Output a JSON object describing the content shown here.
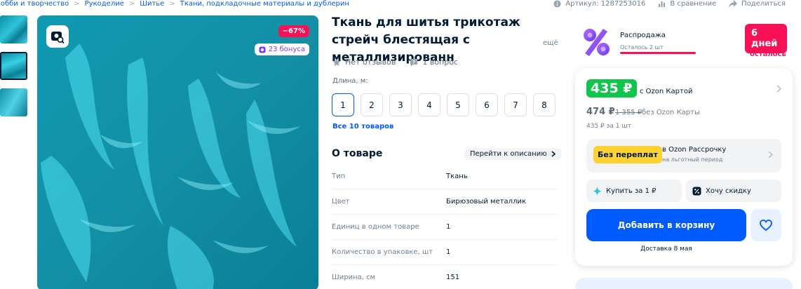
{
  "breadcrumbs": [
    "Хобби и творчество",
    "Рукоделие",
    "Шитье",
    "Ткани, подкладочные материалы и дублерин"
  ],
  "top_actions": {
    "article": "Артикул: 1287253016",
    "compare": "В сравнение",
    "share": "Поделиться"
  },
  "gallery": {
    "discount": "−67%",
    "bonus": "23 бонуса"
  },
  "product": {
    "title": "Ткань для шитья трикотаж стрейч блестящая с металлизированн",
    "more": "ещё",
    "reviews": "Нет отзывов",
    "questions": "1 вопрос",
    "length_label": "Длина, м:",
    "sizes": [
      "1",
      "2",
      "3",
      "4",
      "5",
      "6",
      "7",
      "8"
    ],
    "all_items": "Все 10 товаров"
  },
  "about": {
    "title": "О товаре",
    "to_description": "Перейти к описанию",
    "specs": [
      {
        "k": "Тип",
        "v": "Ткань"
      },
      {
        "k": "Цвет",
        "v": "Бирюзовый металлик"
      },
      {
        "k": "Единиц в одном товаре",
        "v": "1"
      },
      {
        "k": "Количество в упаковке, шт",
        "v": "1"
      },
      {
        "k": "Ширина, см",
        "v": "151"
      }
    ]
  },
  "promo": {
    "title": "Распродажа",
    "subtitle": "Осталось 2 шт",
    "days": "6 дней",
    "left": "осталось"
  },
  "buy": {
    "price_card": "435 ₽",
    "with_card": "с Ozon Картой",
    "price": "474 ₽",
    "old_price": "1 355 ₽",
    "without_card": "без Ozon Карты",
    "per_unit": "435 ₽ за 1 шт",
    "no_overpay": "Без переплат",
    "installment_title": "в Ozon Рассрочку",
    "installment_sub": "на льготный период",
    "buy_for": "Купить за 1 ₽",
    "want_discount": "Хочу скидку",
    "add_to_cart": "Добавить в корзину",
    "delivery": "Доставка 8 мая"
  },
  "colors": {
    "accent": "#005bff",
    "sale": "#f91155",
    "price_green": "#10c44c",
    "installment_yellow": "#ffd233"
  }
}
